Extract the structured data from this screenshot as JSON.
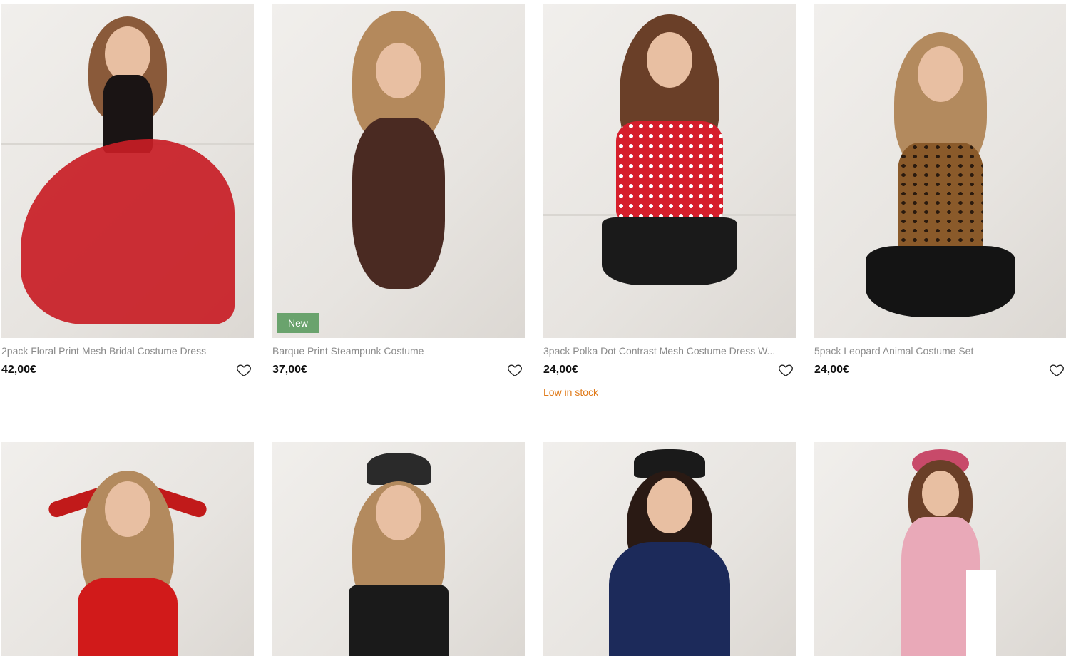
{
  "products": [
    {
      "title": "2pack Floral Print Mesh Bridal Costume Dress",
      "price": "42,00€",
      "badge": "",
      "stock": "",
      "palette": {
        "outfit": "#1a1414",
        "accent": "#c81d25",
        "hair": "#8a5a3a"
      }
    },
    {
      "title": "Barque Print Steampunk Costume",
      "price": "37,00€",
      "badge": "New",
      "stock": "",
      "palette": {
        "outfit": "#4a2a22",
        "accent": "#2a1a16",
        "hair": "#b4895c"
      }
    },
    {
      "title": "3pack Polka Dot Contrast Mesh Costume Dress W...",
      "price": "24,00€",
      "badge": "",
      "stock": "Low in stock",
      "palette": {
        "outfit": "#d61f2c",
        "accent": "#1a1a1a",
        "hair": "#6a3f28"
      }
    },
    {
      "title": "5pack Leopard Animal Costume Set",
      "price": "24,00€",
      "badge": "",
      "stock": "",
      "palette": {
        "outfit": "#8a5a2a",
        "accent": "#141414",
        "hair": "#b38a5e"
      }
    },
    {
      "title": "",
      "price": "",
      "badge": "",
      "stock": "",
      "palette": {
        "outfit": "#d11a1a",
        "accent": "#c11a1a",
        "hair": "#b38a5e"
      }
    },
    {
      "title": "",
      "price": "",
      "badge": "",
      "stock": "",
      "palette": {
        "outfit": "#1a1a1a",
        "accent": "#2a2a2a",
        "hair": "#b38a5e"
      }
    },
    {
      "title": "",
      "price": "",
      "badge": "",
      "stock": "",
      "palette": {
        "outfit": "#1c2a5a",
        "accent": "#1a1a1a",
        "hair": "#2a1a14"
      }
    },
    {
      "title": "",
      "price": "",
      "badge": "",
      "stock": "",
      "palette": {
        "outfit": "#e9a9b8",
        "accent": "#c84a6a",
        "hair": "#6a3f28"
      }
    }
  ],
  "icons": {
    "heart": "heart-icon"
  },
  "colors": {
    "badge": "#6aa36d",
    "stock": "#e07b1b",
    "title": "#8a8a8a",
    "price": "#111111"
  }
}
